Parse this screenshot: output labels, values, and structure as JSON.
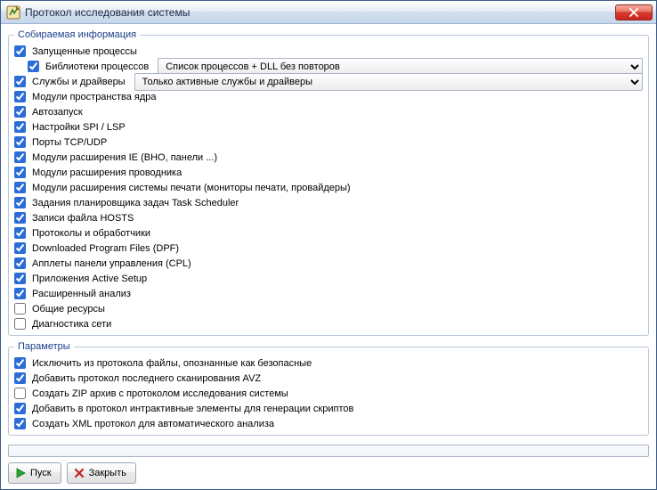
{
  "window": {
    "title": "Протокол исследования системы"
  },
  "groups": {
    "info_legend": "Собираемая информация",
    "params_legend": "Параметры"
  },
  "combos": {
    "process_libs": "Список процессов + DLL без повторов",
    "services": "Только активные службы и драйверы"
  },
  "info_items": {
    "running_processes": "Запущенные процессы",
    "process_libs": "Библиотеки процессов",
    "services_drivers": "Службы и драйверы",
    "kernel_modules": "Модули пространства ядра",
    "autorun": "Автозапуск",
    "spi_lsp": "Настройки SPI / LSP",
    "tcp_udp": "Порты TCP/UDP",
    "ie_ext": "Модули расширения IE (BHO, панели ...)",
    "explorer_ext": "Модули расширения проводника",
    "print_ext": "Модули расширения системы печати (мониторы печати, провайдеры)",
    "task_scheduler": "Задания планировщика задач Task Scheduler",
    "hosts": "Записи файла HOSTS",
    "protocols": "Протоколы и обработчики",
    "dpf": "Downloaded Program Files (DPF)",
    "cpl": "Апплеты панели управления (CPL)",
    "active_setup": "Приложения Active Setup",
    "ext_analysis": "Расширенный анализ",
    "shared_res": "Общие ресурсы",
    "net_diag": "Диагностика сети"
  },
  "param_items": {
    "exclude_safe": "Исключить из протокола файлы, опознанные как безопасные",
    "add_last_scan": "Добавить протокол последнего сканирования AVZ",
    "create_zip": "Создать ZIP архив с протоколом исследования системы",
    "add_interactive": "Добавить в протокол интрактивные элементы для генерации скриптов",
    "create_xml": "Создать XML протокол для автоматического анализа"
  },
  "buttons": {
    "start": "Пуск",
    "close": "Закрыть"
  },
  "checked": {
    "running_processes": true,
    "process_libs": true,
    "services_drivers": true,
    "kernel_modules": true,
    "autorun": true,
    "spi_lsp": true,
    "tcp_udp": true,
    "ie_ext": true,
    "explorer_ext": true,
    "print_ext": true,
    "task_scheduler": true,
    "hosts": true,
    "protocols": true,
    "dpf": true,
    "cpl": true,
    "active_setup": true,
    "ext_analysis": true,
    "shared_res": false,
    "net_diag": false,
    "exclude_safe": true,
    "add_last_scan": true,
    "create_zip": false,
    "add_interactive": true,
    "create_xml": true
  }
}
